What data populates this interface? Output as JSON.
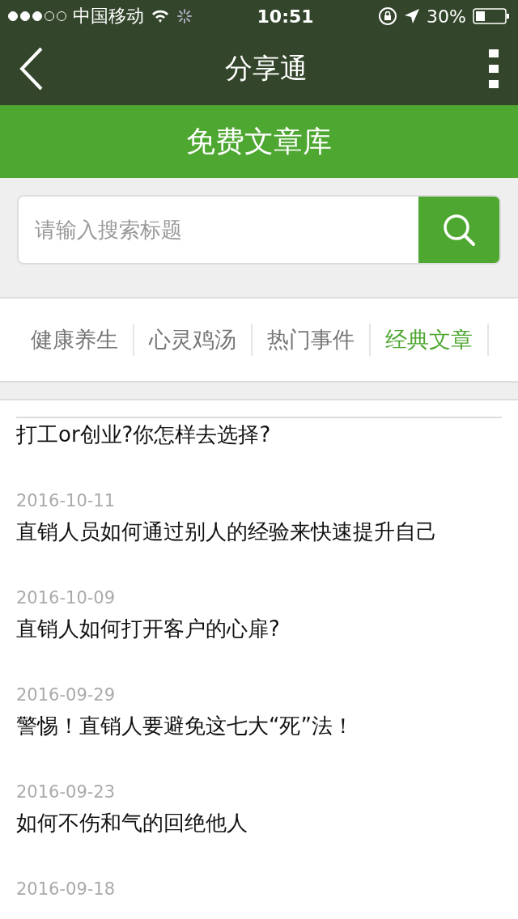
{
  "status_bar": {
    "carrier": "中国移动",
    "time": "10:51",
    "battery": "30%"
  },
  "nav": {
    "title": "分享通"
  },
  "banner": {
    "title": "免费文章库"
  },
  "search": {
    "placeholder": "请输入搜索标题"
  },
  "tabs": [
    {
      "label": "健康养生",
      "selected": false
    },
    {
      "label": "心灵鸡汤",
      "selected": false
    },
    {
      "label": "热门事件",
      "selected": false
    },
    {
      "label": "经典文章",
      "selected": true
    }
  ],
  "articles": [
    {
      "title": "打工or创业?你怎样去选择?"
    },
    {
      "date": "2016-10-11",
      "title": "直销人员如何通过别人的经验来快速提升自己"
    },
    {
      "date": "2016-10-09",
      "title": "直销人如何打开客户的心扉?"
    },
    {
      "date": "2016-09-29",
      "title": "警惕！直销人要避免这七大“死”法！"
    },
    {
      "date": "2016-09-23",
      "title": "如何不伤和气的回绝他人"
    },
    {
      "date": "2016-09-18"
    }
  ]
}
